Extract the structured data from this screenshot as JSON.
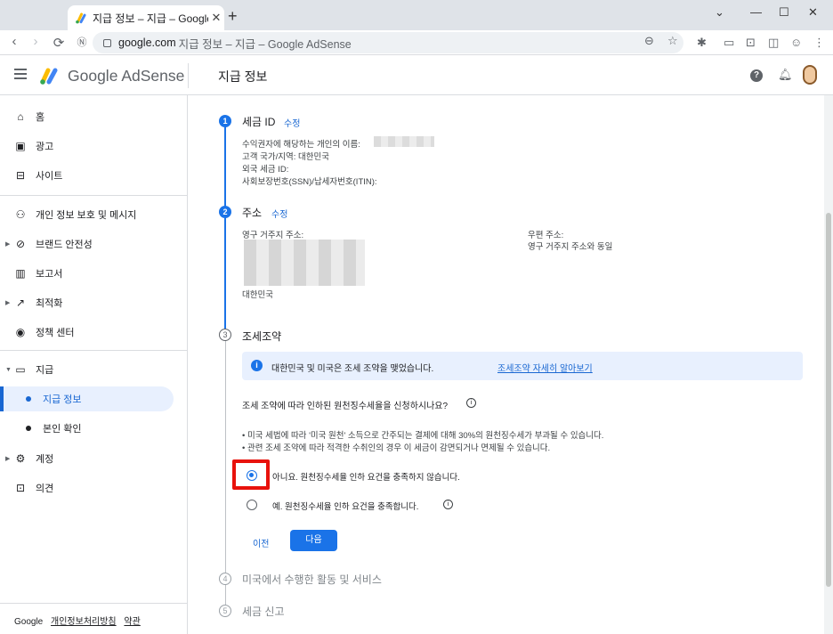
{
  "browser": {
    "tab_title": "지급 정보 – 지급 – Google AdSe",
    "url_host": "google.com",
    "url_rest": "지급 정보 – 지급 – Google AdSense"
  },
  "app": {
    "product_name": "Google AdSense",
    "page_title": "지급 정보",
    "help_glyph": "?"
  },
  "sidebar": {
    "items": [
      {
        "label": "홈",
        "icon": "home-icon"
      },
      {
        "label": "광고",
        "icon": "ads-icon"
      },
      {
        "label": "사이트",
        "icon": "sites-icon"
      },
      {
        "label": "개인 정보 보호 및 메시지",
        "icon": "privacy-icon"
      },
      {
        "label": "브랜드 안전성",
        "icon": "block-icon"
      },
      {
        "label": "보고서",
        "icon": "reports-icon"
      },
      {
        "label": "최적화",
        "icon": "trending-icon"
      },
      {
        "label": "정책 센터",
        "icon": "policy-icon"
      },
      {
        "label": "지급",
        "icon": "payments-icon"
      },
      {
        "label": "지급 정보"
      },
      {
        "label": "본인 확인"
      },
      {
        "label": "계정",
        "icon": "gear-icon"
      },
      {
        "label": "의견",
        "icon": "feedback-icon"
      }
    ],
    "footer": {
      "brand": "Google",
      "privacy": "개인정보처리방침",
      "terms": "약관"
    }
  },
  "steps": {
    "s1": {
      "num": "1",
      "title": "세금 ID",
      "edit": "수정",
      "lines": [
        "수익권자에 해당하는 개인의 이름:",
        "고객 국가/지역: 대한민국",
        "외국 세금 ID:",
        "사회보장번호(SSN)/납세자번호(ITIN):"
      ]
    },
    "s2": {
      "num": "2",
      "title": "주소",
      "edit": "수정",
      "perm_label": "영구 거주지 주소:",
      "country": "대한민국",
      "mail_label": "우편 주소:",
      "mail_value": "영구 거주지 주소와 동일"
    },
    "s3": {
      "num": "3",
      "title": "조세조약",
      "info_text": "대한민국 및 미국은 조세 조약을 맺었습니다.",
      "info_link": "조세조약 자세히 알아보기",
      "question": "조세 조약에 따라 인하된 원천징수세율을 신청하시나요?",
      "bullets": [
        "• 미국 세법에 따라 '미국 원천' 소득으로 간주되는 결제에 대해 30%의 원천징수세가 부과될 수 있습니다.",
        "• 관련 조세 조약에 따라 적격한 수취인의 경우 이 세금이 감면되거나 면제될 수 있습니다."
      ],
      "option_no": "아니요. 원천징수세율 인하 요건을 충족하지 않습니다.",
      "option_yes": "예. 원천징수세율 인하 요건을 충족합니다.",
      "btn_prev": "이전",
      "btn_next": "다음"
    },
    "s4": {
      "num": "4",
      "title": "미국에서 수행한 활동 및 서비스"
    },
    "s5": {
      "num": "5",
      "title": "세금 신고"
    }
  }
}
